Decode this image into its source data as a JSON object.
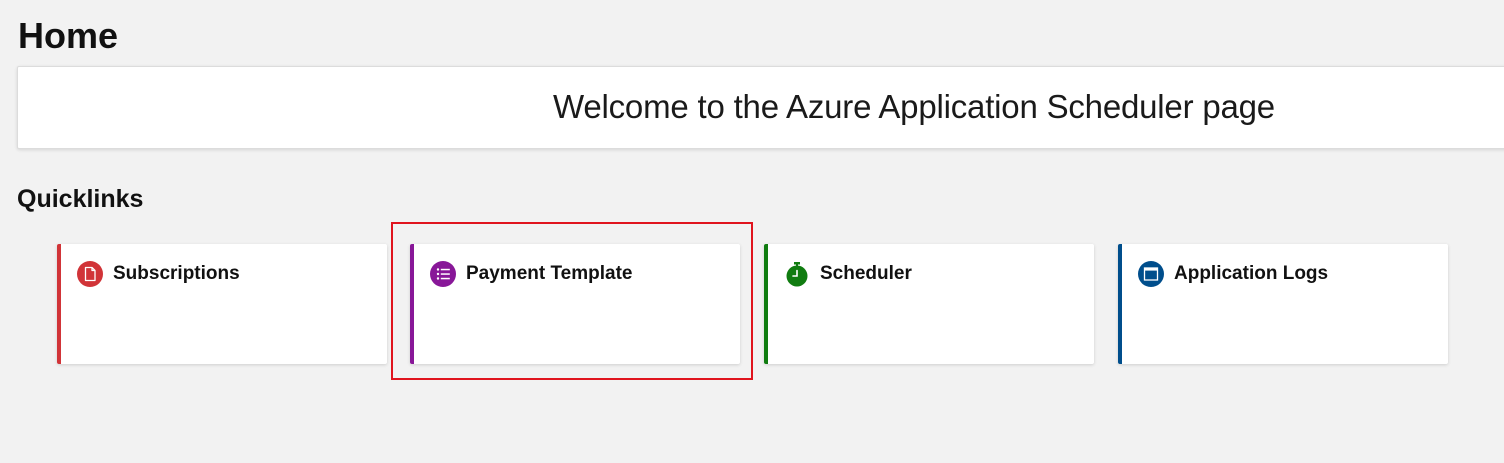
{
  "page": {
    "title": "Home"
  },
  "welcome": {
    "message": "Welcome to the Azure Application Scheduler page"
  },
  "quicklinks": {
    "heading": "Quicklinks",
    "tiles": [
      {
        "label": "Subscriptions",
        "icon": "document-icon",
        "accent_color": "#d13438"
      },
      {
        "label": "Payment Template",
        "icon": "list-icon",
        "accent_color": "#881798",
        "highlighted": true
      },
      {
        "label": "Scheduler",
        "icon": "stopwatch-icon",
        "accent_color": "#107c10"
      },
      {
        "label": "Application Logs",
        "icon": "window-icon",
        "accent_color": "#004e8c"
      }
    ]
  },
  "highlight": {
    "color": "#e0141e",
    "target": "Payment Template"
  }
}
